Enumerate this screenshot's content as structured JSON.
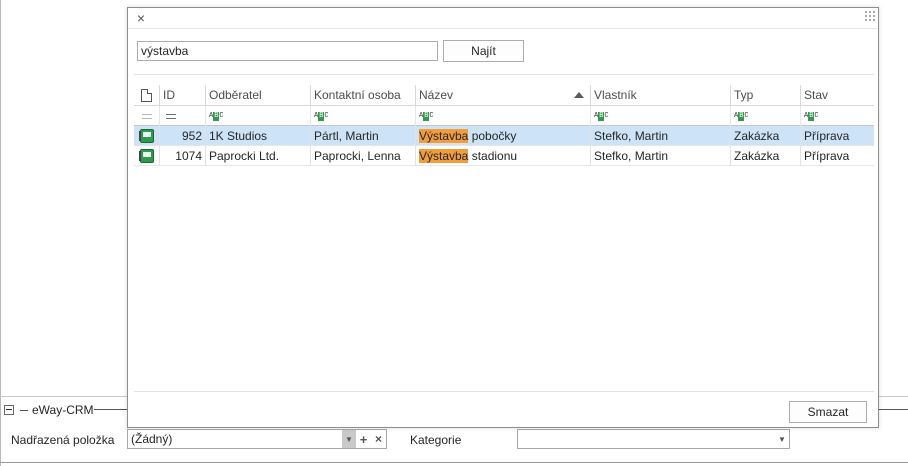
{
  "dialog": {
    "search": {
      "value": "výstavba",
      "placeholder": ""
    },
    "find_label": "Najít",
    "clear_label": "Smazat",
    "grid": {
      "headers": {
        "id": "ID",
        "customer": "Odběratel",
        "contact": "Kontaktní osoba",
        "name": "Název",
        "owner": "Vlastník",
        "type": "Typ",
        "status": "Stav"
      },
      "sort_column": "Název",
      "sort_direction": "ascending",
      "rows": [
        {
          "id": "952",
          "customer": "1K Studios",
          "contact": "Pártl, Martin",
          "name_highlight": "Výstavba",
          "name_rest": " pobočky",
          "owner": "Stefko, Martin",
          "type": "Zakázka",
          "status": "Příprava",
          "selected": true
        },
        {
          "id": "1074",
          "customer": "Paprocki Ltd.",
          "contact": "Paprocki, Lenna",
          "name_highlight": "Výstavba",
          "name_rest": " stadionu",
          "owner": "Stefko, Martin",
          "type": "Zakázka",
          "status": "Příprava",
          "selected": false
        }
      ]
    }
  },
  "background": {
    "group_title": "eWay-CRM",
    "parent_label": "Nadřazená položka",
    "parent_value": "(Žádný)",
    "category_label": "Kategorie",
    "category_value": ""
  },
  "colors": {
    "selection": "#cde3f7",
    "highlight": "#f29d3b",
    "icon_green": "#2d9a50"
  }
}
